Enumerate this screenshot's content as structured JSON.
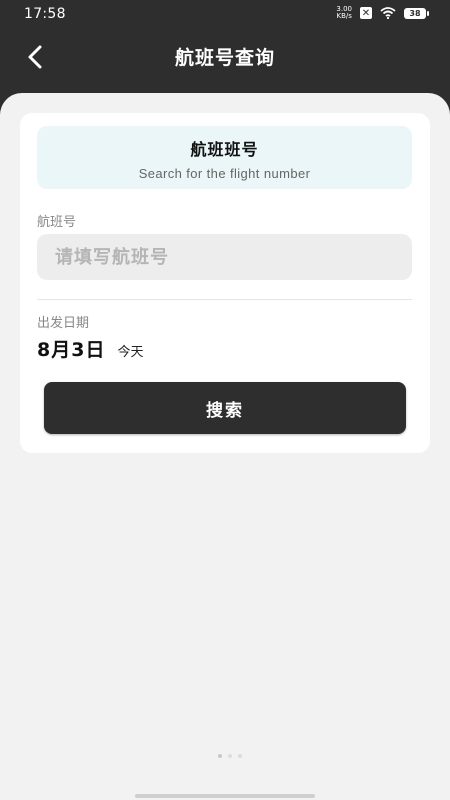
{
  "status_bar": {
    "time": "17:58",
    "net_speed_value": "3.00",
    "net_speed_unit": "KB/s",
    "battery": "38"
  },
  "nav": {
    "title": "航班号查询"
  },
  "card": {
    "header_title": "航班班号",
    "header_subtitle": "Search for the flight number",
    "flight_label": "航班号",
    "flight_placeholder": "请填写航班号",
    "flight_value": "",
    "date_label": "出发日期",
    "date_value": "8月3日",
    "date_note": "今天",
    "search_label": "搜索"
  },
  "colors": {
    "dark": "#2e2e2e",
    "header_bg": "#eaf6f7",
    "page_bg": "#f2f2f2"
  }
}
